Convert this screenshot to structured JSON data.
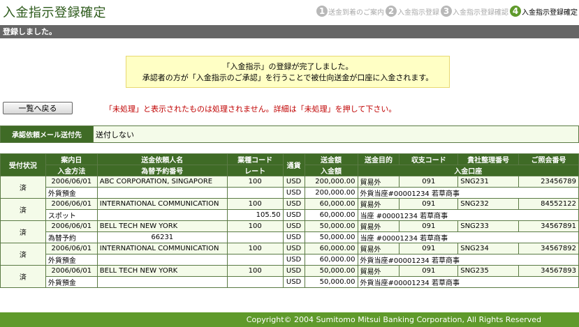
{
  "page": {
    "title": "入金指示登録確定"
  },
  "steps": [
    {
      "num": "1",
      "label": "送金到着のご案内"
    },
    {
      "num": "2",
      "label": "入金指示登録"
    },
    {
      "num": "3",
      "label": "入金指示登録確認"
    },
    {
      "num": "4",
      "label": "入金指示登録確定"
    }
  ],
  "titlebar": {
    "text": "登録しました。"
  },
  "message": {
    "line1": "「入金指示」の登録が完了しました。",
    "line2": "承認者の方が「入金指示のご承認」を行うことで被仕向送金が口座に入金されます。"
  },
  "back_button": {
    "label": "一覧へ戻る"
  },
  "warning": "「未処理」と表示されたものは処理されません。詳細は「未処理」を押して下さい。",
  "mail": {
    "label": "承認依頼メール送付先",
    "value": "送付しない"
  },
  "table": {
    "headers": {
      "status": "受付状況",
      "date": "案内日",
      "method": "入金方法",
      "sender": "送金依頼人名",
      "fx_no": "為替予約番号",
      "biz_code": "業種コード",
      "rate": "レート",
      "currency": "通貨",
      "amount": "送金額",
      "deposit_amount": "入金額",
      "purpose": "送金目的",
      "balance_code": "収支コード",
      "ref_no": "貴社整理番号",
      "inquiry_no": "ご照会番号",
      "account": "入金口座"
    },
    "rows": [
      {
        "status": "済",
        "date": "2006/06/01",
        "sender": "ABC CORPORATION, SINGAPORE",
        "biz_code": "100",
        "currency": "USD",
        "amount": "200,000.00",
        "purpose": "貿易外",
        "balance_code": "091",
        "ref_no": "SNG231",
        "inquiry_no": "23456789",
        "method": "外貨預金",
        "fx_no": "",
        "rate": "",
        "currency2": "USD",
        "deposit_amount": "200,000.00",
        "account": "外貨当座#00001234 若草商事"
      },
      {
        "status": "済",
        "date": "2006/06/01",
        "sender": "INTERNATIONAL COMMUNICATION",
        "biz_code": "100",
        "currency": "USD",
        "amount": "60,000.00",
        "purpose": "貿易外",
        "balance_code": "091",
        "ref_no": "SNG232",
        "inquiry_no": "84552122",
        "method": "スポット",
        "fx_no": "",
        "rate": "105.50",
        "currency2": "USD",
        "deposit_amount": "60,000.00",
        "account": "当座 #00001234 若草商事"
      },
      {
        "status": "済",
        "date": "2006/06/01",
        "sender": "BELL TECH NEW YORK",
        "biz_code": "100",
        "currency": "USD",
        "amount": "50,000.00",
        "purpose": "貿易外",
        "balance_code": "091",
        "ref_no": "SNG233",
        "inquiry_no": "34567891",
        "method": "為替予約",
        "fx_no": "66231",
        "rate": "",
        "currency2": "USD",
        "deposit_amount": "50,000.00",
        "account": "当座 #00001234 若草商事"
      },
      {
        "status": "済",
        "date": "2006/06/01",
        "sender": "INTERNATIONAL COMMUNICATION",
        "biz_code": "100",
        "currency": "USD",
        "amount": "60,000.00",
        "purpose": "貿易外",
        "balance_code": "091",
        "ref_no": "SNG234",
        "inquiry_no": "34567892",
        "method": "外貨預金",
        "fx_no": "",
        "rate": "",
        "currency2": "USD",
        "deposit_amount": "60,000.00",
        "account": "外貨当座#00001234 若草商事"
      },
      {
        "status": "済",
        "date": "2006/06/01",
        "sender": "BELL TECH NEW YORK",
        "biz_code": "100",
        "currency": "USD",
        "amount": "50,000.00",
        "purpose": "貿易外",
        "balance_code": "091",
        "ref_no": "SNG235",
        "inquiry_no": "34567893",
        "method": "外貨預金",
        "fx_no": "",
        "rate": "",
        "currency2": "USD",
        "deposit_amount": "50,000.00",
        "account": "外貨当座#00001234 若草商事"
      }
    ]
  },
  "footer": {
    "copyright": "Copyright© 2004 Sumitomo Mitsui Banking Corporation, All Rights Reserved"
  }
}
